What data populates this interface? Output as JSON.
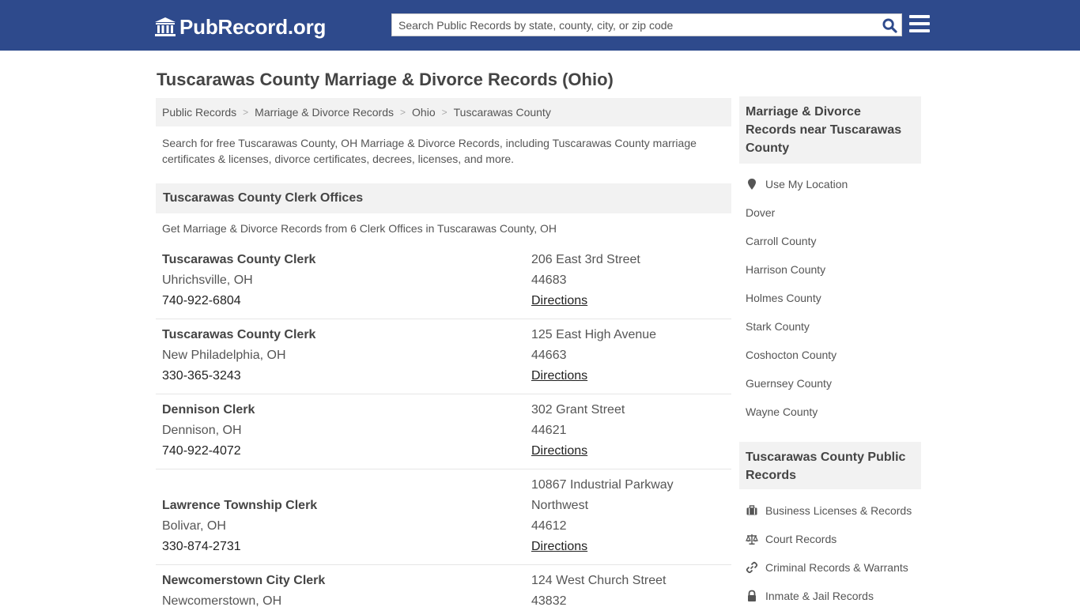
{
  "header": {
    "logo_text": "PubRecord.org",
    "search_placeholder": "Search Public Records by state, county, city, or zip code"
  },
  "page_title": "Tuscarawas County Marriage & Divorce Records (Ohio)",
  "breadcrumb": [
    "Public Records",
    "Marriage & Divorce Records",
    "Ohio",
    "Tuscarawas County"
  ],
  "intro": "Search for free Tuscarawas County, OH Marriage & Divorce Records, including Tuscarawas County marriage certificates & licenses, divorce certificates, decrees, licenses, and more.",
  "clerk_section": {
    "title": "Tuscarawas County Clerk Offices",
    "subtitle": "Get Marriage & Divorce Records from 6 Clerk Offices in Tuscarawas County, OH",
    "directions_label": "Directions",
    "offices": [
      {
        "name": "Tuscarawas County Clerk",
        "city": "Uhrichsville, OH",
        "phone": "740-922-6804",
        "address": [
          "206 East 3rd Street"
        ],
        "zip": "44683"
      },
      {
        "name": "Tuscarawas County Clerk",
        "city": "New Philadelphia, OH",
        "phone": "330-365-3243",
        "address": [
          "125 East High Avenue"
        ],
        "zip": "44663"
      },
      {
        "name": "Dennison Clerk",
        "city": "Dennison, OH",
        "phone": "740-922-4072",
        "address": [
          "302 Grant Street"
        ],
        "zip": "44621"
      },
      {
        "name": "Lawrence Township Clerk",
        "city": "Bolivar, OH",
        "phone": "330-874-2731",
        "address": [
          "10867 Industrial Parkway",
          "Northwest"
        ],
        "zip": "44612"
      },
      {
        "name": "Newcomerstown City Clerk",
        "city": "Newcomerstown, OH",
        "phone": "",
        "address": [
          "124 West Church Street"
        ],
        "zip": "43832"
      }
    ]
  },
  "sidebar": {
    "nearby_title": "Marriage & Divorce Records near Tuscarawas County",
    "use_location": "Use My Location",
    "nearby": [
      "Dover",
      "Carroll County",
      "Harrison County",
      "Holmes County",
      "Stark County",
      "Coshocton County",
      "Guernsey County",
      "Wayne County"
    ],
    "public_title": "Tuscarawas County Public Records",
    "public_records": [
      {
        "label": "Business Licenses & Records",
        "icon": "briefcase-icon"
      },
      {
        "label": "Court Records",
        "icon": "scales-icon"
      },
      {
        "label": "Criminal Records & Warrants",
        "icon": "link-icon"
      },
      {
        "label": "Inmate & Jail Records",
        "icon": "lock-icon"
      }
    ]
  },
  "colors": {
    "header_bg": "#2e4a8c",
    "panel_bg": "#f2f2f2",
    "search_icon": "#2e4a8c"
  }
}
